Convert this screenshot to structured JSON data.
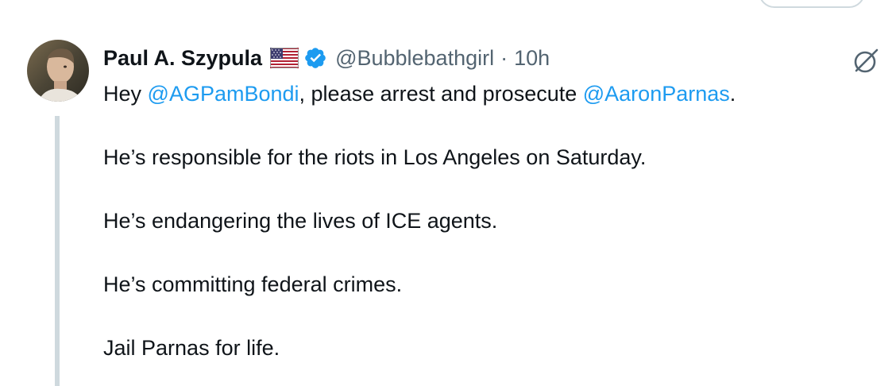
{
  "tweet": {
    "author": {
      "display_name": "Paul A. Szypula",
      "flag_icon": "us-flag-icon",
      "verified_icon": "verified-badge-icon",
      "handle": "@Bubblebathgirl",
      "separator": "·",
      "time": "10h"
    },
    "body": {
      "line1_prefix": "Hey ",
      "mention1": "@AGPamBondi",
      "line1_middle": ", please arrest and prosecute ",
      "mention2": "@AaronParnas",
      "line1_suffix": ".",
      "line2": "He’s responsible for the riots in Los Angeles on Saturday.",
      "line3": "He’s endangering the lives of ICE agents.",
      "line4": "He’s committing federal crimes.",
      "line5": "Jail Parnas for life."
    },
    "colors": {
      "link": "#1d9bf0",
      "secondary_text": "#536471",
      "verified": "#1d9bf0",
      "thread_line": "#cfd9de"
    }
  }
}
